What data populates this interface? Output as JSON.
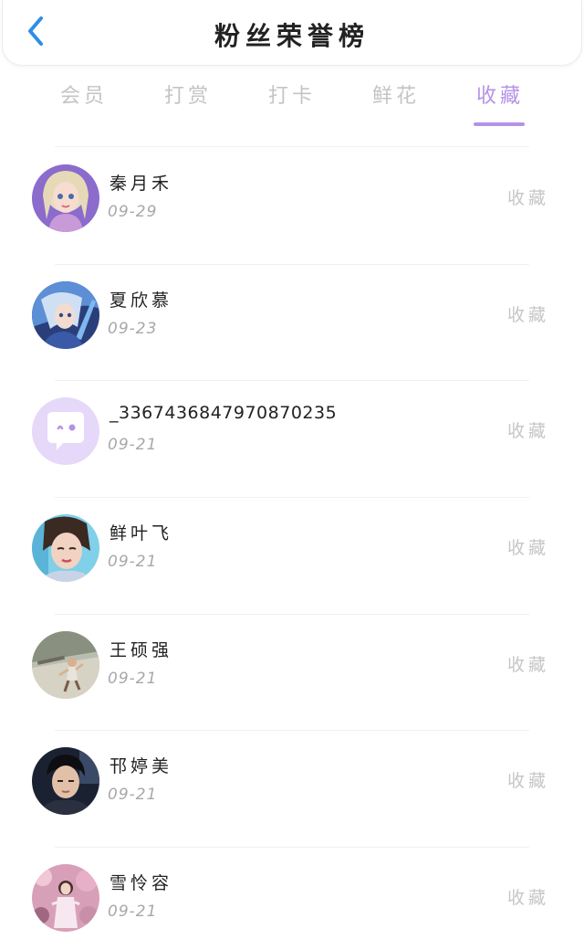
{
  "header": {
    "title": "粉丝荣誉榜"
  },
  "tabs": [
    {
      "label": "会员"
    },
    {
      "label": "打赏"
    },
    {
      "label": "打卡"
    },
    {
      "label": "鲜花"
    },
    {
      "label": "收藏",
      "active": true
    }
  ],
  "colors": {
    "accent": "#b493e6",
    "back": "#2e8ee8",
    "muted": "#c4c4c4"
  },
  "list": [
    {
      "name": "秦月禾",
      "date": "09-29",
      "action": "收藏",
      "avatar": "anime-girl-blonde-avatar"
    },
    {
      "name": "夏欣慕",
      "date": "09-23",
      "action": "收藏",
      "avatar": "anime-girl-blue-avatar"
    },
    {
      "name": "_3367436847970870235",
      "date": "09-21",
      "action": "收藏",
      "avatar": "default-chat-bubble-avatar"
    },
    {
      "name": "鲜叶飞",
      "date": "09-21",
      "action": "收藏",
      "avatar": "woman-portrait-avatar"
    },
    {
      "name": "王硕强",
      "date": "09-21",
      "action": "收藏",
      "avatar": "outdoor-person-avatar"
    },
    {
      "name": "邗婷美",
      "date": "09-21",
      "action": "收藏",
      "avatar": "young-man-dark-avatar"
    },
    {
      "name": "雪怜容",
      "date": "09-21",
      "action": "收藏",
      "avatar": "pink-blossom-girl-avatar"
    }
  ]
}
